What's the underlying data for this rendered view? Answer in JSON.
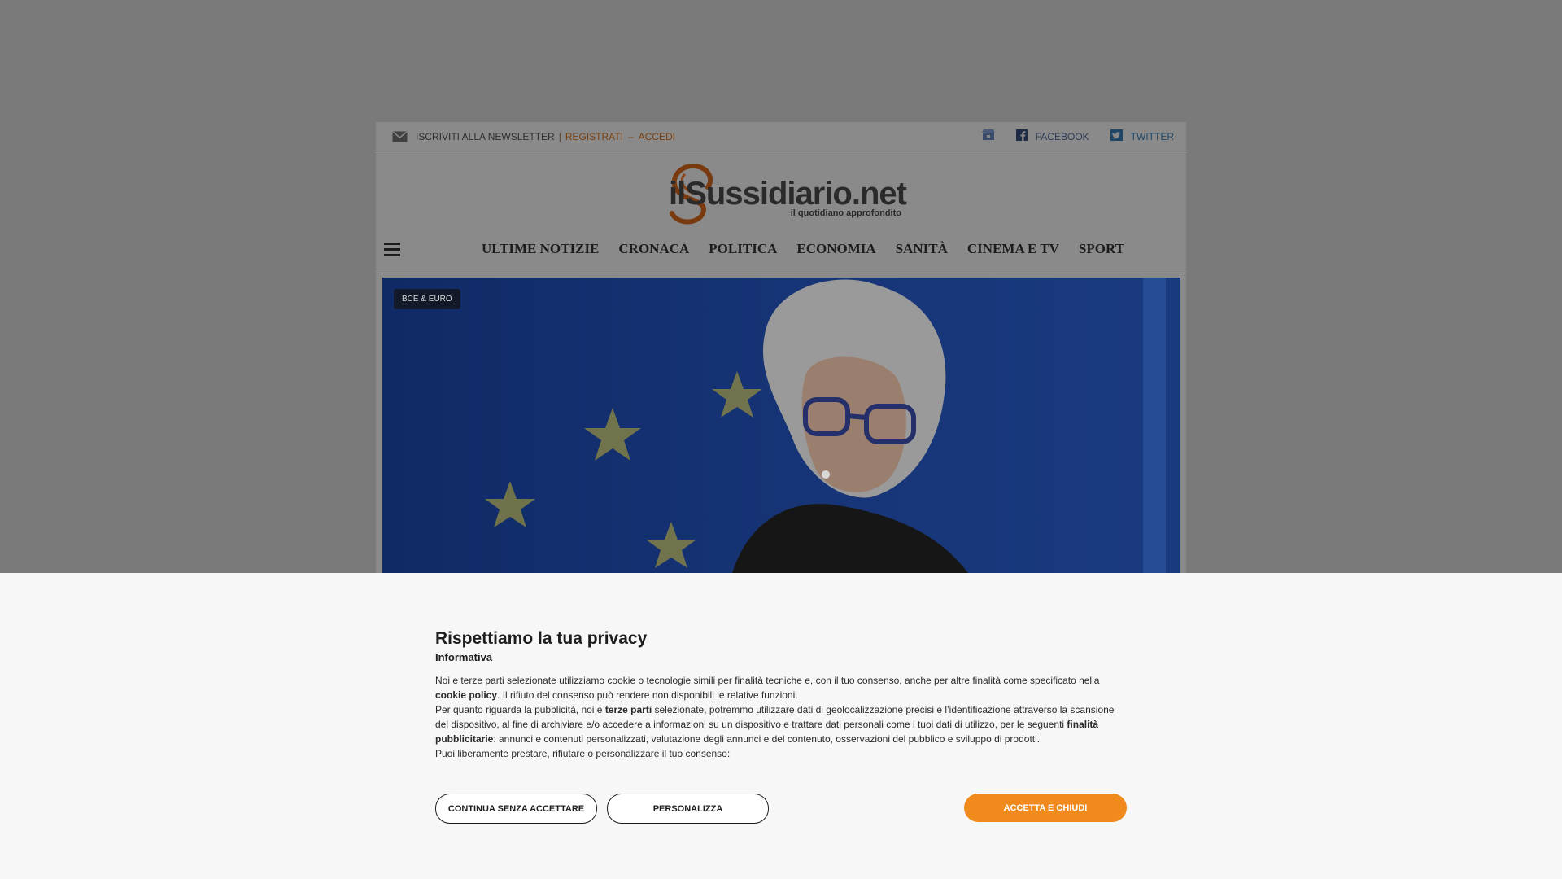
{
  "topbar": {
    "newsletter": "ISCRIVITI ALLA NEWSLETTER",
    "register": "REGISTRATI",
    "login": "ACCEDI",
    "facebook": "FACEBOOK",
    "twitter": "TWITTER"
  },
  "logo": {
    "name": "ilSussidiario.net",
    "tagline": "il quotidiano approfondito"
  },
  "nav": {
    "items": [
      "ULTIME NOTIZIE",
      "CRONACA",
      "POLITICA",
      "ECONOMIA",
      "SANITÀ",
      "CINEMA E TV",
      "SPORT"
    ]
  },
  "hero": {
    "badge": "BCE & EURO"
  },
  "consent": {
    "title": "Rispettiamo la tua privacy",
    "subtitle": "Informativa",
    "p1_a": "Noi e terze parti selezionate utilizziamo cookie o tecnologie simili per finalità tecniche e, con il tuo consenso, anche per altre finalità come specificato nella ",
    "p1_b": "cookie policy",
    "p1_c": ". Il rifiuto del consenso può rendere non disponibili le relative funzioni.",
    "p2_a": "Per quanto riguarda la pubblicità, noi e ",
    "p2_b": "terze parti",
    "p2_c": " selezionate, potremmo utilizzare dati di geolocalizzazione precisi e l’identificazione attraverso la scansione del dispositivo, al fine di archiviare e/o accedere a informazioni su un dispositivo e trattare dati personali come i tuoi dati di utilizzo, per le seguenti ",
    "p2_d": "finalità pubblicitarie",
    "p2_e": ": annunci e contenuti personalizzati, valutazione degli annunci e del contenuto, osservazioni del pubblico e sviluppo di prodotti.",
    "p3": "Puoi liberamente prestare, rifiutare o personalizzare il tuo consenso:",
    "btn_continue": "CONTINUA SENZA ACCETTARE",
    "btn_customize": "PERSONALIZZA",
    "btn_accept": "ACCETTA E CHIUDI"
  },
  "colors": {
    "accent": "#f08a1d",
    "overlay": "#7a7a7a",
    "banner_bg": "#f7f7f8"
  }
}
